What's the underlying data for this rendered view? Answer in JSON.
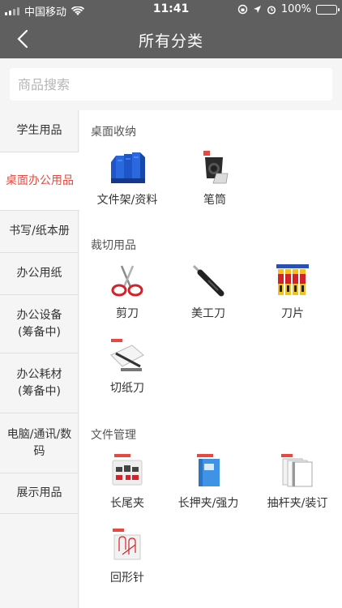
{
  "status": {
    "carrier": "中国移动",
    "time": "11:41",
    "battery": "100%"
  },
  "nav": {
    "title": "所有分类"
  },
  "search": {
    "placeholder": "商品搜索"
  },
  "sidebar": {
    "items": [
      {
        "label": "学生用品",
        "active": false
      },
      {
        "label": "桌面办公用品",
        "active": true
      },
      {
        "label": "书写/纸本册",
        "active": false
      },
      {
        "label": "办公用纸",
        "active": false
      },
      {
        "label": "办公设备\n(筹备中)",
        "active": false
      },
      {
        "label": "办公耗材\n(筹备中)",
        "active": false
      },
      {
        "label": "电脑/通讯/数码",
        "active": false
      },
      {
        "label": "展示用品",
        "active": false
      }
    ]
  },
  "sections": [
    {
      "title": "桌面收纳",
      "items": [
        {
          "label": "文件架/资料",
          "icon": "file-rack-icon"
        },
        {
          "label": "笔筒",
          "icon": "pen-holder-icon"
        }
      ]
    },
    {
      "title": "裁切用品",
      "items": [
        {
          "label": "剪刀",
          "icon": "scissors-icon"
        },
        {
          "label": "美工刀",
          "icon": "utility-knife-icon"
        },
        {
          "label": "刀片",
          "icon": "blades-icon"
        },
        {
          "label": "切纸刀",
          "icon": "paper-cutter-icon"
        }
      ]
    },
    {
      "title": "文件管理",
      "items": [
        {
          "label": "长尾夹",
          "icon": "binder-clip-icon"
        },
        {
          "label": "长押夹/强力",
          "icon": "folder-clip-icon"
        },
        {
          "label": "抽杆夹/装订",
          "icon": "report-cover-icon"
        },
        {
          "label": "回形针",
          "icon": "paper-clip-icon"
        }
      ]
    }
  ]
}
